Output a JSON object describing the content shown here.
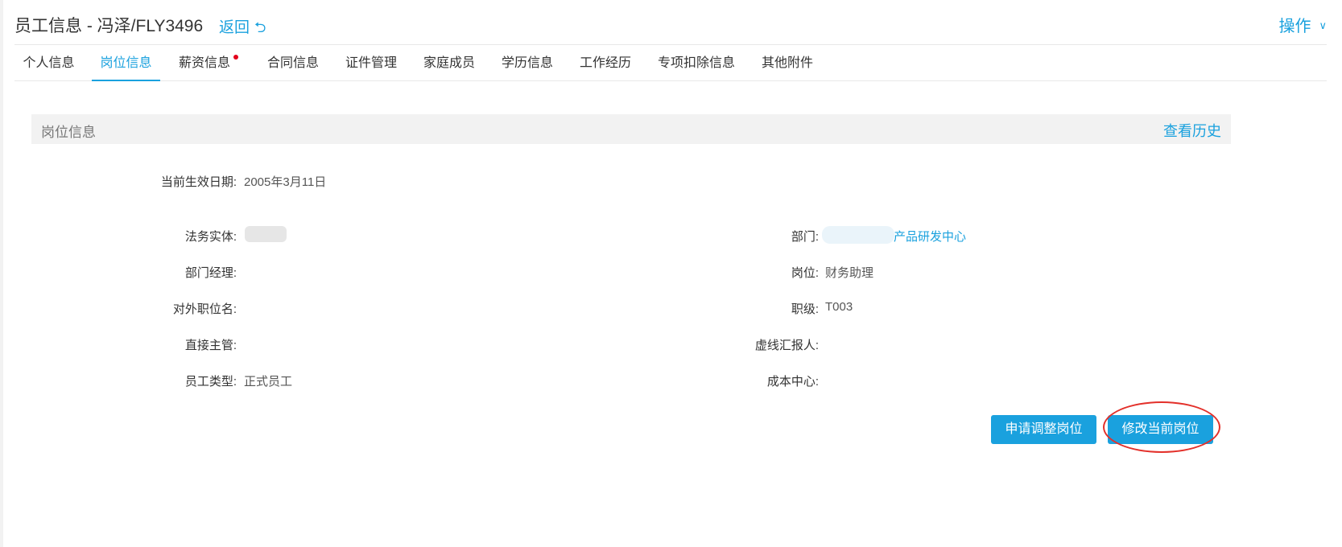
{
  "header": {
    "title": "员工信息 - 冯泽/FLY3496",
    "back_label": "返回",
    "back_icon": "return-icon",
    "ops_label": "操作",
    "ops_icon": "chevron-down-icon"
  },
  "tabs": [
    {
      "label": "个人信息",
      "active": false
    },
    {
      "label": "岗位信息",
      "active": true
    },
    {
      "label": "薪资信息",
      "active": false,
      "badge": "red-dot"
    },
    {
      "label": "合同信息",
      "active": false
    },
    {
      "label": "证件管理",
      "active": false
    },
    {
      "label": "家庭成员",
      "active": false
    },
    {
      "label": "学历信息",
      "active": false
    },
    {
      "label": "工作经历",
      "active": false
    },
    {
      "label": "专项扣除信息",
      "active": false
    },
    {
      "label": "其他附件",
      "active": false
    }
  ],
  "section": {
    "title": "岗位信息",
    "history_label": "查看历史"
  },
  "effective_date": {
    "label": "当前生效日期:",
    "value": "2005年3月11日"
  },
  "fields_left": [
    {
      "label": "法务实体:",
      "value": ""
    },
    {
      "label": "部门经理:",
      "value": ""
    },
    {
      "label": "对外职位名:",
      "value": ""
    },
    {
      "label": "直接主管:",
      "value": ""
    },
    {
      "label": "员工类型:",
      "value": "正式员工"
    }
  ],
  "fields_right": [
    {
      "label": "部门:",
      "value": "产品研发中心"
    },
    {
      "label": "岗位:",
      "value": "财务助理"
    },
    {
      "label": "职级:",
      "value": "T003"
    },
    {
      "label": "虚线汇报人:",
      "value": ""
    },
    {
      "label": "成本中心:",
      "value": ""
    }
  ],
  "actions": {
    "apply_adjust_label": "申请调整岗位",
    "modify_current_label": "修改当前岗位"
  },
  "colors": {
    "accent": "#1aa1de",
    "highlight_ring": "#e3302a",
    "badge": "#e3001b"
  }
}
